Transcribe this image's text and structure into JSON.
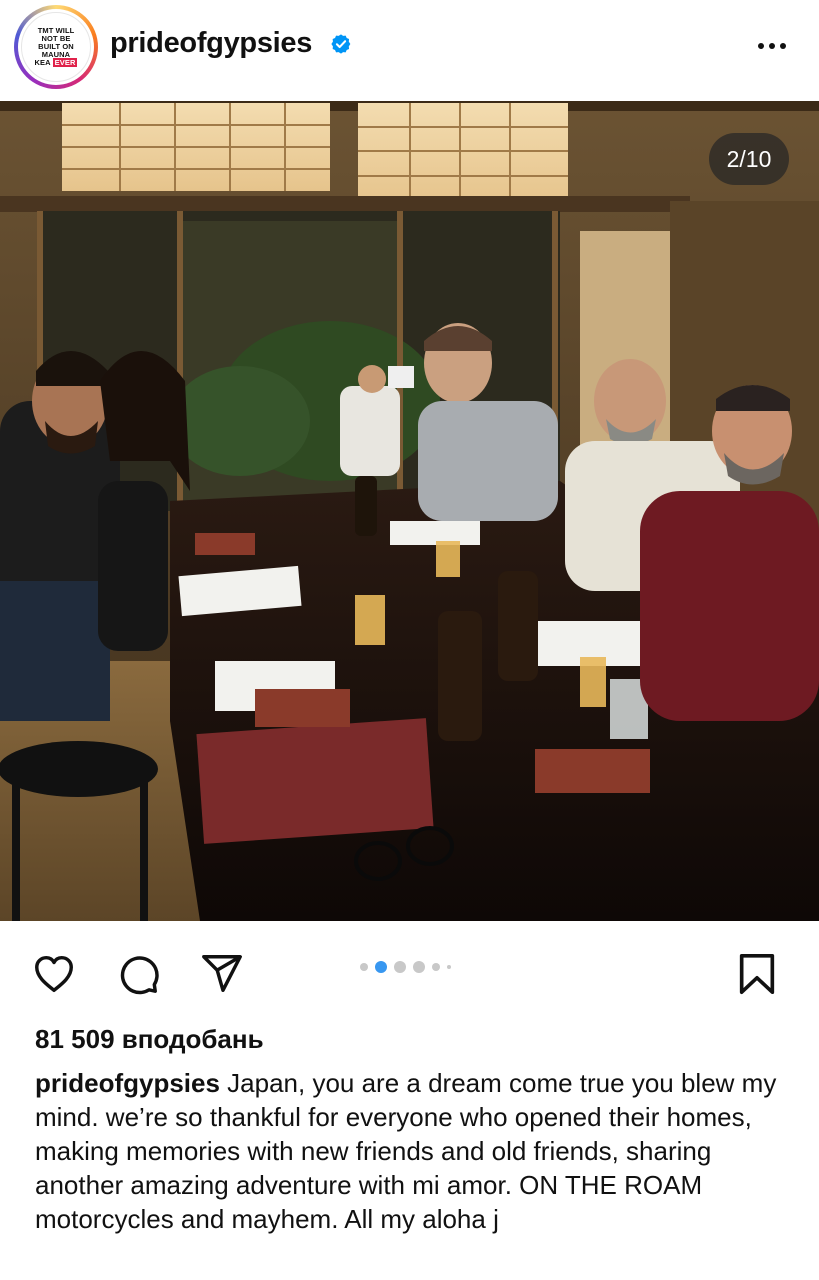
{
  "header": {
    "avatar_text": [
      "TMT WILL",
      "NOT BE",
      "BUILT ON",
      "MAUNA",
      "KEA",
      "EVER"
    ],
    "username": "prideofgypsies",
    "verified": true,
    "more_icon": "more-horizontal-icon"
  },
  "post": {
    "image_description_icon": "photo",
    "counter": "2/10",
    "carousel_total_dots": 6,
    "carousel_active_index": 1
  },
  "actions": {
    "like_icon": "heart-icon",
    "comment_icon": "comment-icon",
    "share_icon": "send-icon",
    "save_icon": "bookmark-icon"
  },
  "likes": {
    "text": "81 509 вподобань"
  },
  "caption": {
    "username": "prideofgypsies",
    "text": " Japan, you are a dream come true you blew my mind. we’re so thankful for everyone who opened their homes, making memories with new friends and old friends, sharing another amazing adventure with mi amor. ON THE ROAM  motorcycles and mayhem. All my aloha j"
  },
  "colors": {
    "verified_blue": "#0095f6",
    "text": "#111111",
    "dot_inactive": "#c8c8c8",
    "dot_active": "#3897f0"
  }
}
